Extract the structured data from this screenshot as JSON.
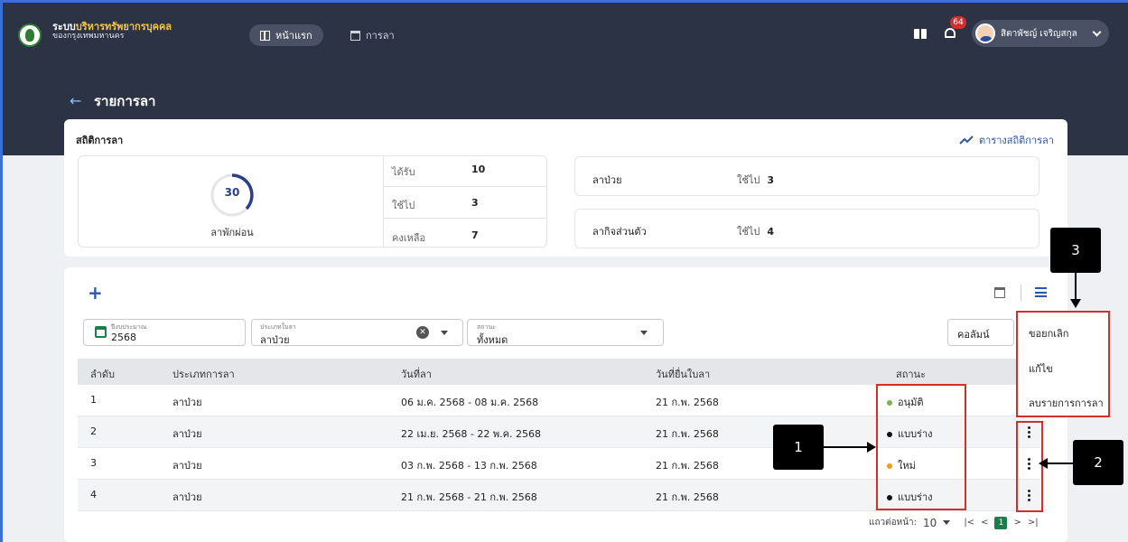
{
  "app": {
    "brand_line1_a": "ระบบ",
    "brand_line1_b": "บริหารทรัพยากรบุคคล",
    "brand_line2": "ของกรุงเทพมหานคร",
    "nav_home": "หน้าแรก",
    "nav_leave": "การลา",
    "notification_count": "64",
    "user_name": "สิตาพัชญ์ เจริญสกุล"
  },
  "page": {
    "title": "รายการลา",
    "back_icon": "arrow-left-icon"
  },
  "stats": {
    "title": "สถิติการลา",
    "link_label": "ตารางสถิติการลา",
    "vacation": {
      "days": "30",
      "label": "ลาพักผ่อน",
      "rows": [
        {
          "label": "ได้รับ",
          "value": "10"
        },
        {
          "label": "ใช้ไป",
          "value": "3"
        },
        {
          "label": "คงเหลือ",
          "value": "7"
        }
      ]
    },
    "sick": {
      "name": "ลาป่วย",
      "used_label": "ใช้ไป",
      "used_value": "3"
    },
    "personal": {
      "name": "ลากิจส่วนตัว",
      "used_label": "ใช้ไป",
      "used_value": "4"
    }
  },
  "filters": {
    "fiscal_year_label": "ปีงบประมาณ",
    "fiscal_year_value": "2568",
    "leave_type_label": "ประเภทใบลา",
    "leave_type_value": "ลาป่วย",
    "status_label": "สถานะ",
    "status_value": "ทั้งหมด",
    "columns_label": "คอลัมน์"
  },
  "table": {
    "headers": [
      "ลำดับ",
      "ประเภทการลา",
      "วันที่ลา",
      "วันที่ยื่นใบลา",
      "สถานะ"
    ],
    "rows": [
      {
        "no": "1",
        "type": "ลาป่วย",
        "dates": "06 ม.ค. 2568 - 08 ม.ค. 2568",
        "submitted": "21 ก.พ. 2568",
        "status": "อนุมัติ",
        "status_color": "#7cb342"
      },
      {
        "no": "2",
        "type": "ลาป่วย",
        "dates": "22 เม.ย. 2568 - 22 พ.ค. 2568",
        "submitted": "21 ก.พ. 2568",
        "status": "แบบร่าง",
        "status_color": "#111111"
      },
      {
        "no": "3",
        "type": "ลาป่วย",
        "dates": "03 ก.พ. 2568 - 13 ก.พ. 2568",
        "submitted": "21 ก.พ. 2568",
        "status": "ใหม่",
        "status_color": "#f39c12"
      },
      {
        "no": "4",
        "type": "ลาป่วย",
        "dates": "21 ก.พ. 2568 - 21 ก.พ. 2568",
        "submitted": "21 ก.พ. 2568",
        "status": "แบบร่าง",
        "status_color": "#111111"
      }
    ]
  },
  "pager": {
    "rows_per_page_label": "แถวต่อหน้า:",
    "rows_per_page": "10",
    "current_page": "1"
  },
  "menu": {
    "items": [
      "ขอยกเลิก",
      "แก้ไข",
      "ลบรายการการลา"
    ]
  },
  "annotations": {
    "c1": "1",
    "c2": "2",
    "c3": "3"
  }
}
